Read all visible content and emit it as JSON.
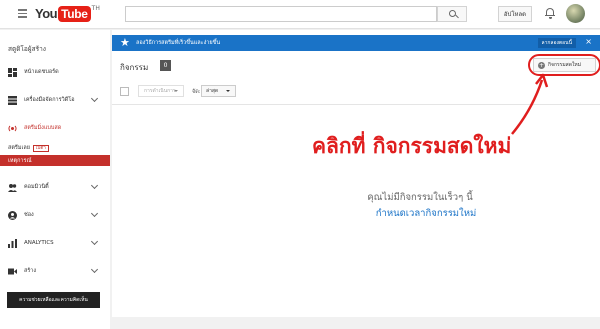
{
  "header": {
    "logo_you": "You",
    "logo_tube": "Tube",
    "logo_country": "TH",
    "search_placeholder": "",
    "upload_label": "อัปโหลด",
    "icons": [
      "menu-icon",
      "search-icon",
      "bell-icon",
      "avatar"
    ]
  },
  "sidebar": {
    "title": "สตูดิโอผู้สร้าง",
    "items": [
      {
        "label": "หน้าแดชบอร์ด",
        "icon": "dashboard-icon"
      },
      {
        "label": "เครื่องมือจัดการวิดีโอ",
        "icon": "video-manager-icon"
      },
      {
        "label": "สตรีมมิ่งแบบสด",
        "icon": "live-icon"
      },
      {
        "label": "คอมมิวนิตี้",
        "icon": "community-icon"
      },
      {
        "label": "ช่อง",
        "icon": "channel-icon"
      },
      {
        "label": "ANALYTICS",
        "icon": "analytics-icon"
      },
      {
        "label": "สร้าง",
        "icon": "create-icon"
      }
    ],
    "live_sub": {
      "stream_now": "สตรีมเลย",
      "beta": "เบต้า",
      "events": "เหตุการณ์"
    },
    "help_button": "ความช่วยเหลือและความคิดเห็น"
  },
  "banner": {
    "text": "ลองวิธีการสตรีมที่เร็วขึ้นและง่ายขึ้น",
    "button": "ลากลองตอนนี้",
    "close": "×"
  },
  "events": {
    "title": "กิจกรรม",
    "count": "0",
    "new_event_button": "กิจกรรมสดใหม่",
    "actions_dropdown": "การดำเนินการ",
    "sort_label": "จัด:",
    "sort_value": "ล่าสุด",
    "empty_message": "คุณไม่มีกิจกรรมในเร็วๆ นี้",
    "schedule_link": "กำหนดเวลากิจกรรมใหม่"
  },
  "annotation": {
    "text": "คลิกที่ กิจกรรมสดใหม่",
    "color": "#e01e1e"
  },
  "colors": {
    "banner": "#1a73c7",
    "live_accent": "#c4302b",
    "brand_red": "#e62117"
  }
}
